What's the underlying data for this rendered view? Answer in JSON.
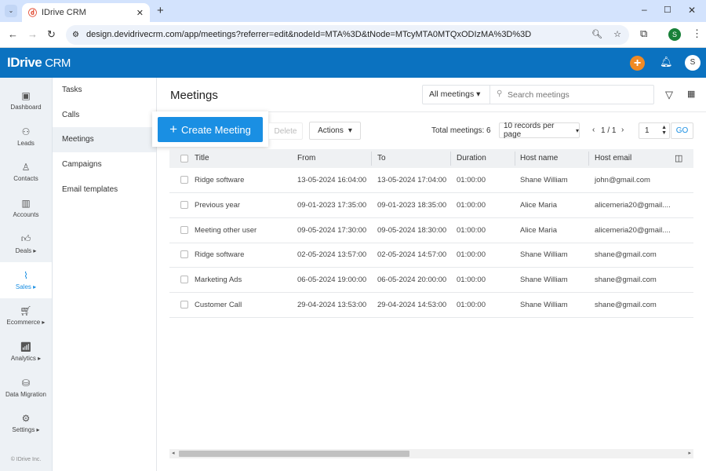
{
  "browser": {
    "tab_title": "IDrive CRM",
    "url": "design.devidrivecrm.com/app/meetings?referrer=edit&nodeId=MTA%3D&tNode=MTcyMTA0MTQxODIzMA%3D%3D",
    "profile_initial": "S"
  },
  "app": {
    "logo": "IDrive",
    "logo_suffix": "CRM",
    "user_initial": "S",
    "colors": {
      "header": "#0b72c0",
      "accent": "#f08a24",
      "primary_button": "#1a8fe3"
    }
  },
  "rail": {
    "items": [
      {
        "label": "Dashboard",
        "icon": "dashboard-icon"
      },
      {
        "label": "Leads",
        "icon": "leads-icon"
      },
      {
        "label": "Contacts",
        "icon": "contacts-icon"
      },
      {
        "label": "Accounts",
        "icon": "accounts-icon"
      },
      {
        "label": "Deals ▸",
        "icon": "deals-icon"
      },
      {
        "label": "Sales ▸",
        "icon": "sales-icon",
        "active": true
      },
      {
        "label": "Ecommerce ▸",
        "icon": "ecommerce-icon"
      },
      {
        "label": "Analytics ▸",
        "icon": "analytics-icon"
      },
      {
        "label": "Data Migration",
        "icon": "data-migration-icon"
      },
      {
        "label": "Settings ▸",
        "icon": "settings-icon"
      }
    ],
    "footer": "© IDrive Inc."
  },
  "submenu": {
    "items": [
      "Tasks",
      "Calls",
      "Meetings",
      "Campaigns",
      "Email templates"
    ],
    "active": "Meetings"
  },
  "main": {
    "title": "Meetings",
    "filter": "All meetings",
    "search_placeholder": "Search meetings",
    "create": "Create Meeting",
    "delete": "Delete",
    "actions": "Actions",
    "total": "Total meetings: 6",
    "per_page": "10 records per page",
    "pager": "1 / 1",
    "page_input": "1",
    "go": "GO"
  },
  "table": {
    "columns": [
      "Title",
      "From",
      "To",
      "Duration",
      "Host name",
      "Host email"
    ],
    "rows": [
      [
        "Ridge software",
        "13-05-2024 16:04:00",
        "13-05-2024 17:04:00",
        "01:00:00",
        "Shane William",
        "john@gmail.com"
      ],
      [
        "Previous year",
        "09-01-2023 17:35:00",
        "09-01-2023 18:35:00",
        "01:00:00",
        "Alice Maria",
        "alicemeria20@gmail...."
      ],
      [
        "Meeting other user",
        "09-05-2024 17:30:00",
        "09-05-2024 18:30:00",
        "01:00:00",
        "Alice Maria",
        "alicemeria20@gmail...."
      ],
      [
        "Ridge software",
        "02-05-2024 13:57:00",
        "02-05-2024 14:57:00",
        "01:00:00",
        "Shane William",
        "shane@gmail.com"
      ],
      [
        "Marketing Ads",
        "06-05-2024 19:00:00",
        "06-05-2024 20:00:00",
        "01:00:00",
        "Shane William",
        "shane@gmail.com"
      ],
      [
        "Customer Call",
        "29-04-2024 13:53:00",
        "29-04-2024 14:53:00",
        "01:00:00",
        "Shane William",
        "shane@gmail.com"
      ]
    ]
  }
}
